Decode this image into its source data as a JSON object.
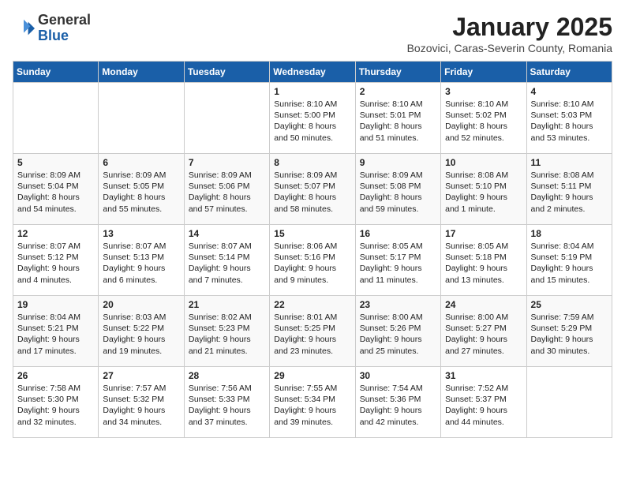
{
  "logo": {
    "general": "General",
    "blue": "Blue"
  },
  "title": "January 2025",
  "subtitle": "Bozovici, Caras-Severin County, Romania",
  "days_of_week": [
    "Sunday",
    "Monday",
    "Tuesday",
    "Wednesday",
    "Thursday",
    "Friday",
    "Saturday"
  ],
  "weeks": [
    [
      {
        "day": "",
        "info": ""
      },
      {
        "day": "",
        "info": ""
      },
      {
        "day": "",
        "info": ""
      },
      {
        "day": "1",
        "info": "Sunrise: 8:10 AM\nSunset: 5:00 PM\nDaylight: 8 hours\nand 50 minutes."
      },
      {
        "day": "2",
        "info": "Sunrise: 8:10 AM\nSunset: 5:01 PM\nDaylight: 8 hours\nand 51 minutes."
      },
      {
        "day": "3",
        "info": "Sunrise: 8:10 AM\nSunset: 5:02 PM\nDaylight: 8 hours\nand 52 minutes."
      },
      {
        "day": "4",
        "info": "Sunrise: 8:10 AM\nSunset: 5:03 PM\nDaylight: 8 hours\nand 53 minutes."
      }
    ],
    [
      {
        "day": "5",
        "info": "Sunrise: 8:09 AM\nSunset: 5:04 PM\nDaylight: 8 hours\nand 54 minutes."
      },
      {
        "day": "6",
        "info": "Sunrise: 8:09 AM\nSunset: 5:05 PM\nDaylight: 8 hours\nand 55 minutes."
      },
      {
        "day": "7",
        "info": "Sunrise: 8:09 AM\nSunset: 5:06 PM\nDaylight: 8 hours\nand 57 minutes."
      },
      {
        "day": "8",
        "info": "Sunrise: 8:09 AM\nSunset: 5:07 PM\nDaylight: 8 hours\nand 58 minutes."
      },
      {
        "day": "9",
        "info": "Sunrise: 8:09 AM\nSunset: 5:08 PM\nDaylight: 8 hours\nand 59 minutes."
      },
      {
        "day": "10",
        "info": "Sunrise: 8:08 AM\nSunset: 5:10 PM\nDaylight: 9 hours\nand 1 minute."
      },
      {
        "day": "11",
        "info": "Sunrise: 8:08 AM\nSunset: 5:11 PM\nDaylight: 9 hours\nand 2 minutes."
      }
    ],
    [
      {
        "day": "12",
        "info": "Sunrise: 8:07 AM\nSunset: 5:12 PM\nDaylight: 9 hours\nand 4 minutes."
      },
      {
        "day": "13",
        "info": "Sunrise: 8:07 AM\nSunset: 5:13 PM\nDaylight: 9 hours\nand 6 minutes."
      },
      {
        "day": "14",
        "info": "Sunrise: 8:07 AM\nSunset: 5:14 PM\nDaylight: 9 hours\nand 7 minutes."
      },
      {
        "day": "15",
        "info": "Sunrise: 8:06 AM\nSunset: 5:16 PM\nDaylight: 9 hours\nand 9 minutes."
      },
      {
        "day": "16",
        "info": "Sunrise: 8:05 AM\nSunset: 5:17 PM\nDaylight: 9 hours\nand 11 minutes."
      },
      {
        "day": "17",
        "info": "Sunrise: 8:05 AM\nSunset: 5:18 PM\nDaylight: 9 hours\nand 13 minutes."
      },
      {
        "day": "18",
        "info": "Sunrise: 8:04 AM\nSunset: 5:19 PM\nDaylight: 9 hours\nand 15 minutes."
      }
    ],
    [
      {
        "day": "19",
        "info": "Sunrise: 8:04 AM\nSunset: 5:21 PM\nDaylight: 9 hours\nand 17 minutes."
      },
      {
        "day": "20",
        "info": "Sunrise: 8:03 AM\nSunset: 5:22 PM\nDaylight: 9 hours\nand 19 minutes."
      },
      {
        "day": "21",
        "info": "Sunrise: 8:02 AM\nSunset: 5:23 PM\nDaylight: 9 hours\nand 21 minutes."
      },
      {
        "day": "22",
        "info": "Sunrise: 8:01 AM\nSunset: 5:25 PM\nDaylight: 9 hours\nand 23 minutes."
      },
      {
        "day": "23",
        "info": "Sunrise: 8:00 AM\nSunset: 5:26 PM\nDaylight: 9 hours\nand 25 minutes."
      },
      {
        "day": "24",
        "info": "Sunrise: 8:00 AM\nSunset: 5:27 PM\nDaylight: 9 hours\nand 27 minutes."
      },
      {
        "day": "25",
        "info": "Sunrise: 7:59 AM\nSunset: 5:29 PM\nDaylight: 9 hours\nand 30 minutes."
      }
    ],
    [
      {
        "day": "26",
        "info": "Sunrise: 7:58 AM\nSunset: 5:30 PM\nDaylight: 9 hours\nand 32 minutes."
      },
      {
        "day": "27",
        "info": "Sunrise: 7:57 AM\nSunset: 5:32 PM\nDaylight: 9 hours\nand 34 minutes."
      },
      {
        "day": "28",
        "info": "Sunrise: 7:56 AM\nSunset: 5:33 PM\nDaylight: 9 hours\nand 37 minutes."
      },
      {
        "day": "29",
        "info": "Sunrise: 7:55 AM\nSunset: 5:34 PM\nDaylight: 9 hours\nand 39 minutes."
      },
      {
        "day": "30",
        "info": "Sunrise: 7:54 AM\nSunset: 5:36 PM\nDaylight: 9 hours\nand 42 minutes."
      },
      {
        "day": "31",
        "info": "Sunrise: 7:52 AM\nSunset: 5:37 PM\nDaylight: 9 hours\nand 44 minutes."
      },
      {
        "day": "",
        "info": ""
      }
    ]
  ]
}
